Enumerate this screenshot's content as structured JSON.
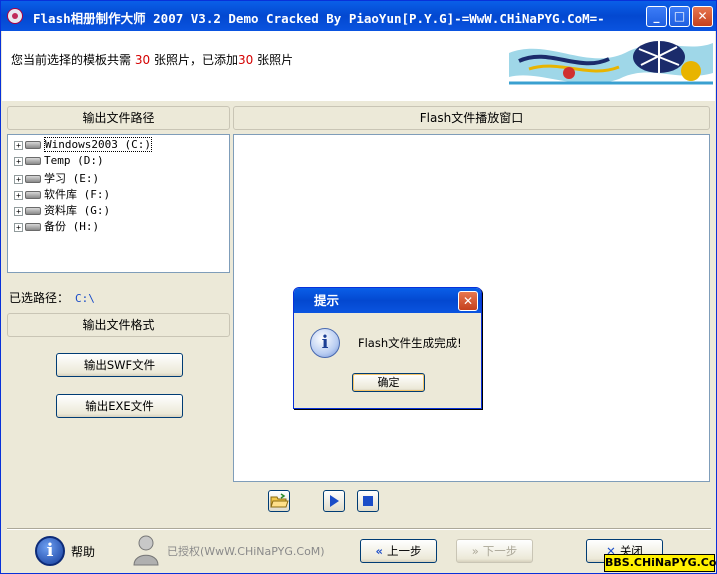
{
  "window": {
    "title": "Flash相册制作大师 2007 V3.2 Demo Cracked By PiaoYun[P.Y.G]-=WwW.CHiNaPYG.CoM=-",
    "minimize_label": "_",
    "maximize_label": "□",
    "close_label": "✕"
  },
  "header": {
    "info_prefix": "您当前选择的模板共需",
    "required_count": "30",
    "info_middle": "张照片，已添加",
    "added_count": "30",
    "info_suffix": "张照片"
  },
  "left_panel": {
    "output_path_header": "输出文件路径",
    "drives": [
      {
        "label": "Windows2003 (C:)"
      },
      {
        "label": "Temp (D:)"
      },
      {
        "label": "学习 (E:)"
      },
      {
        "label": "软件库 (F:)"
      },
      {
        "label": "资料库 (G:)"
      },
      {
        "label": "备份 (H:)"
      }
    ],
    "selected_path_label": "已选路径：",
    "selected_path_value": "C:\\",
    "output_format_header": "输出文件格式",
    "swf_button": "输出SWF文件",
    "exe_button": "输出EXE文件"
  },
  "right_panel": {
    "player_header": "Flash文件播放窗口"
  },
  "footer": {
    "help_label": "帮助",
    "license_label": "已授权(WwW.CHiNaPYG.CoM)",
    "prev_label": "上一步",
    "next_label": "下一步",
    "close_label": "关闭"
  },
  "dialog": {
    "title": "提示",
    "message": "Flash文件生成完成!",
    "ok_label": "确定",
    "close_label": "✕"
  },
  "watermark": "BBS.CHiNaPYG.CoM",
  "colors": {
    "titlebar": "#0A5FE8",
    "face": "#ECE9D8",
    "highlight_count": "#d40000",
    "path_text": "#1a4cc8",
    "watermark_bg": "#fff000"
  }
}
